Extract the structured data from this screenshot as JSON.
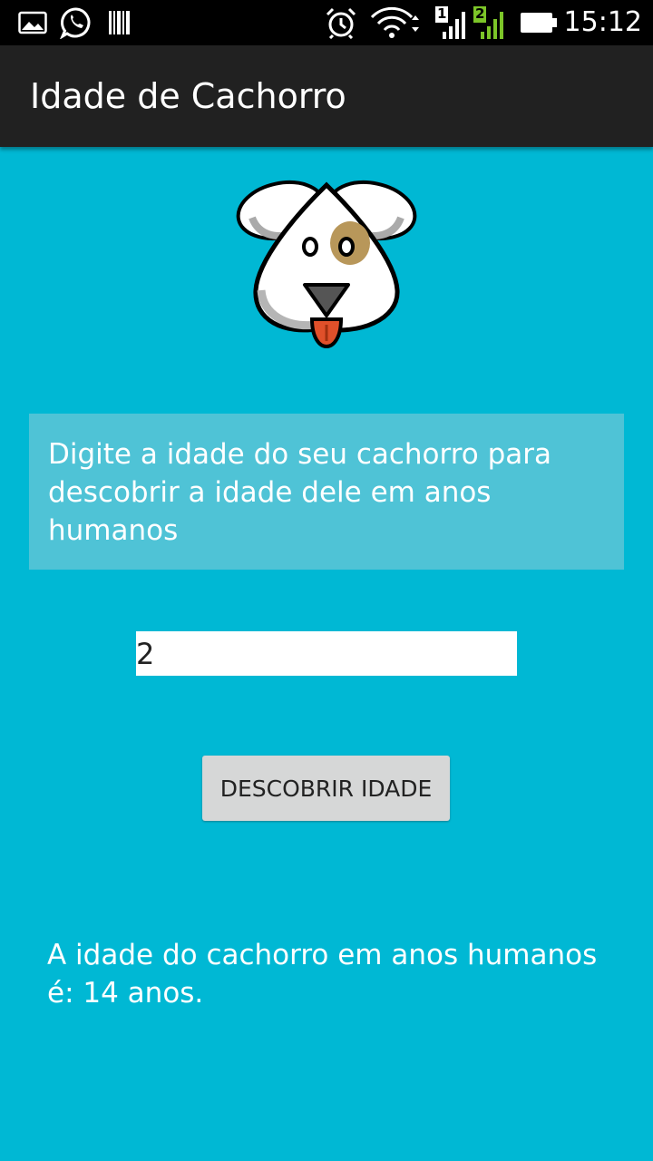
{
  "status_bar": {
    "time": "15:12",
    "sim1_label": "1",
    "sim2_label": "2",
    "icons": [
      "gallery-icon",
      "whatsapp-icon",
      "barcode-icon",
      "alarm-icon",
      "wifi-icon",
      "signal-icon",
      "battery-icon"
    ]
  },
  "app": {
    "title": "Idade de Cachorro"
  },
  "main": {
    "instruction": "Digite a idade do seu cachorro para descobrir a idade dele em anos humanos",
    "age_input_value": "2",
    "button_label": "DESCOBRIR IDADE",
    "result": "A idade do cachorro em anos humanos é: 14 anos."
  },
  "colors": {
    "background": "#00b8d4",
    "action_bar": "#212121",
    "info_box": "#4fc3d6",
    "button": "#d6d7d7"
  }
}
